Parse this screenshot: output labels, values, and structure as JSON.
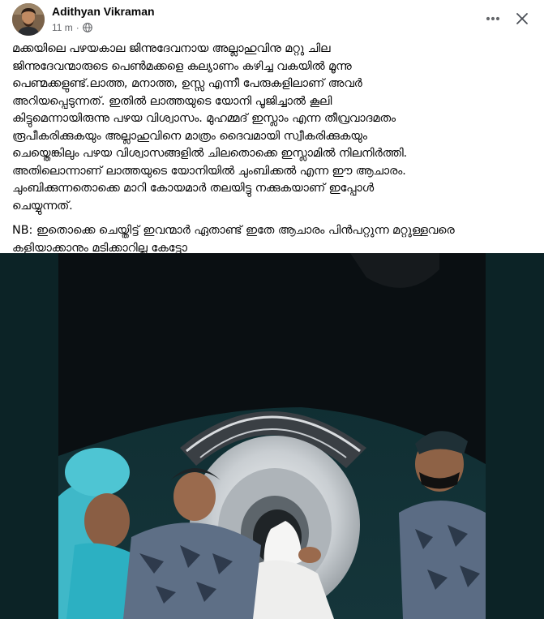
{
  "post": {
    "author": "Adithyan Vikraman",
    "time": "11 m",
    "separator": "·",
    "privacy_icon": "globe-icon",
    "more_icon": "more-horizontal-icon",
    "close_icon": "close-icon",
    "paragraphs": [
      "മക്കയിലെ പഴയകാല ജിന്നുദേവനായ അല്ലാഹുവിനു മറ്റു ചില\nജിന്നുദേവന്മാരുടെ പെൺമക്കളെ കല്യാണം കഴിച്ച വകയിൽ മൂന്നു\nപെണ്മക്കളുണ്ട്.ലാത്ത, മനാത്ത, ഉസ്സ എന്നീ പേരുകളിലാണ് അവർ\nഅറിയപ്പെടുന്നത്. ഇതിൽ ലാത്തയുടെ യോനി പൂജിച്ചാൽ കൂലി\nകിട്ടുമെന്നായിരുന്നു പഴയ വിശ്വാസം. മുഹമ്മദ് ഇസ്ലാം എന്ന തീവ്രവാദമതം\nരൂപീകരിക്കുകയും അല്ലാഹുവിനെ മാത്രം ദൈവമായി സ്വീകരിക്കുകയും\nചെയ്തെങ്കിലും പഴയ വിശ്വാസങ്ങളിൽ ചിലതൊക്കെ ഇസ്ലാമിൽ നിലനിർത്തി.\nഅതിലൊന്നാണ് ലാത്തയുടെ യോനിയിൽ ചുംബിക്കൽ എന്ന ഈ ആചാരം.\nചുംബിക്കുന്നതൊക്കെ മാറി കോയമാർ തലയിട്ടു നക്കുകയാണ് ഇപ്പോൾ\nചെയ്യുന്നത്.",
      "NB: ഇതൊക്കെ ചെയ്തിട്ട് ഇവന്മാർ ഏതാണ്ട് ഇതേ ആചാരം പിൻപറ്റുന്ന മറ്റുള്ളവരെ\nകളിയാക്കാനും മടിക്കാറില്ല കേട്ടോ"
    ]
  },
  "colors": {
    "text": "#050505",
    "meta": "#65676b",
    "photo_bg": "#0c2326"
  }
}
